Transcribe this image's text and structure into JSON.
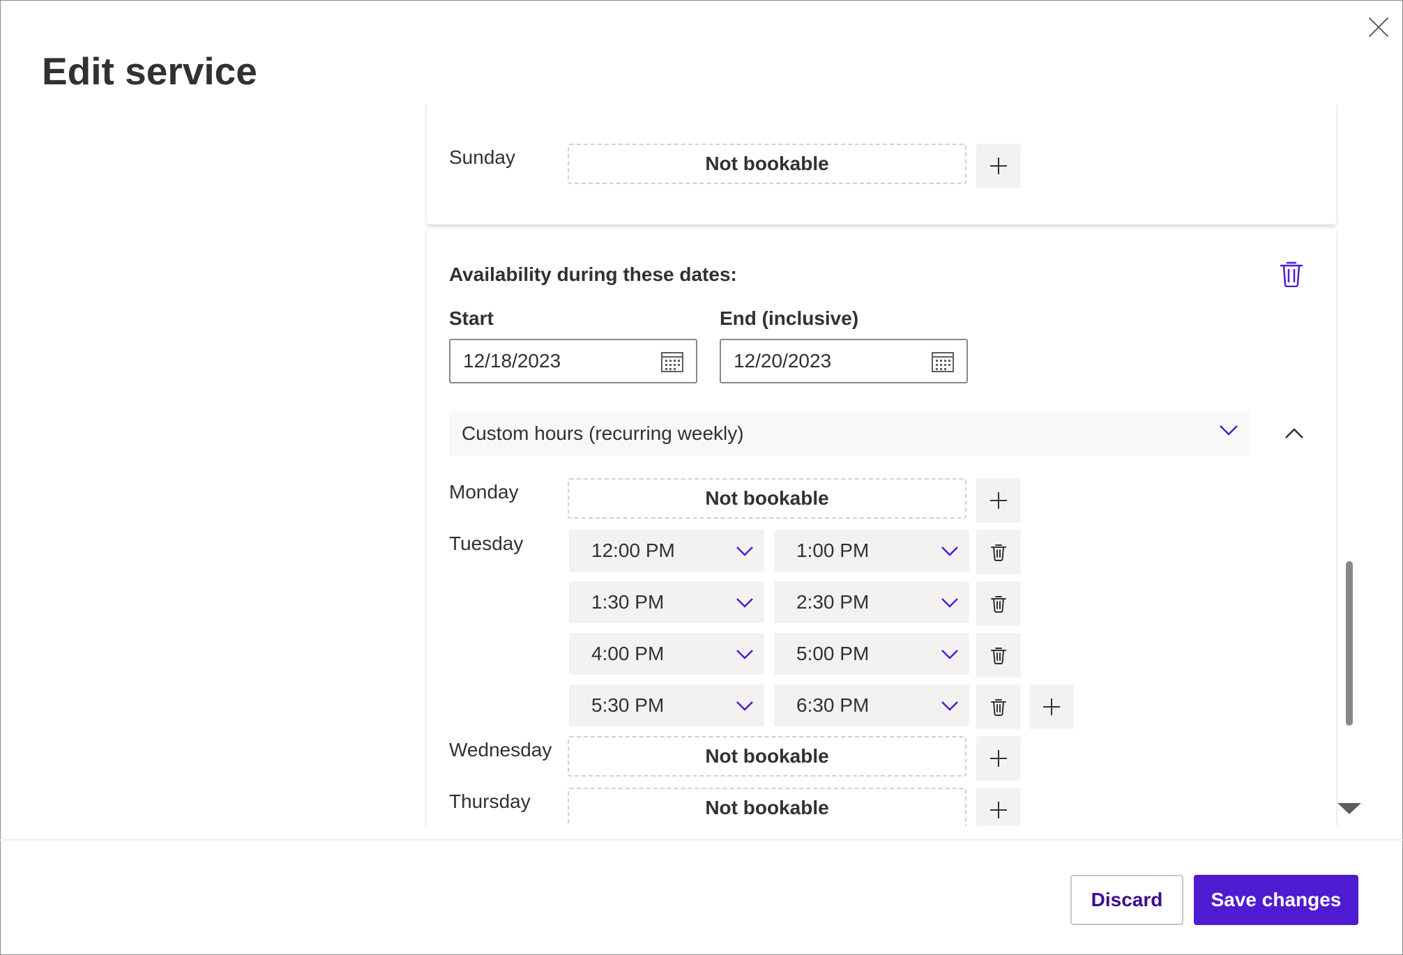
{
  "dialog": {
    "title": "Edit service",
    "close_icon": "close-icon"
  },
  "weekly_card": {
    "sunday": {
      "label": "Sunday",
      "status": "Not bookable"
    }
  },
  "date_range_card": {
    "title": "Availability during these dates:",
    "start_label": "Start",
    "start_value": "12/18/2023",
    "end_label": "End (inclusive)",
    "end_value": "12/20/2023",
    "hours_mode": "Custom hours (recurring weekly)",
    "days": {
      "monday": {
        "label": "Monday",
        "status": "Not bookable"
      },
      "tuesday": {
        "label": "Tuesday",
        "slots": [
          {
            "start": "12:00 PM",
            "end": "1:00 PM"
          },
          {
            "start": "1:30 PM",
            "end": "2:30 PM"
          },
          {
            "start": "4:00 PM",
            "end": "5:00 PM"
          },
          {
            "start": "5:30 PM",
            "end": "6:30 PM"
          }
        ]
      },
      "wednesday": {
        "label": "Wednesday",
        "status": "Not bookable"
      },
      "thursday": {
        "label": "Thursday",
        "status": "Not bookable"
      }
    }
  },
  "footer": {
    "discard_label": "Discard",
    "save_label": "Save changes"
  },
  "colors": {
    "accent": "#4f1bd1",
    "accent_text": "#3b0d8f",
    "chevron": "#4f1bd1"
  }
}
